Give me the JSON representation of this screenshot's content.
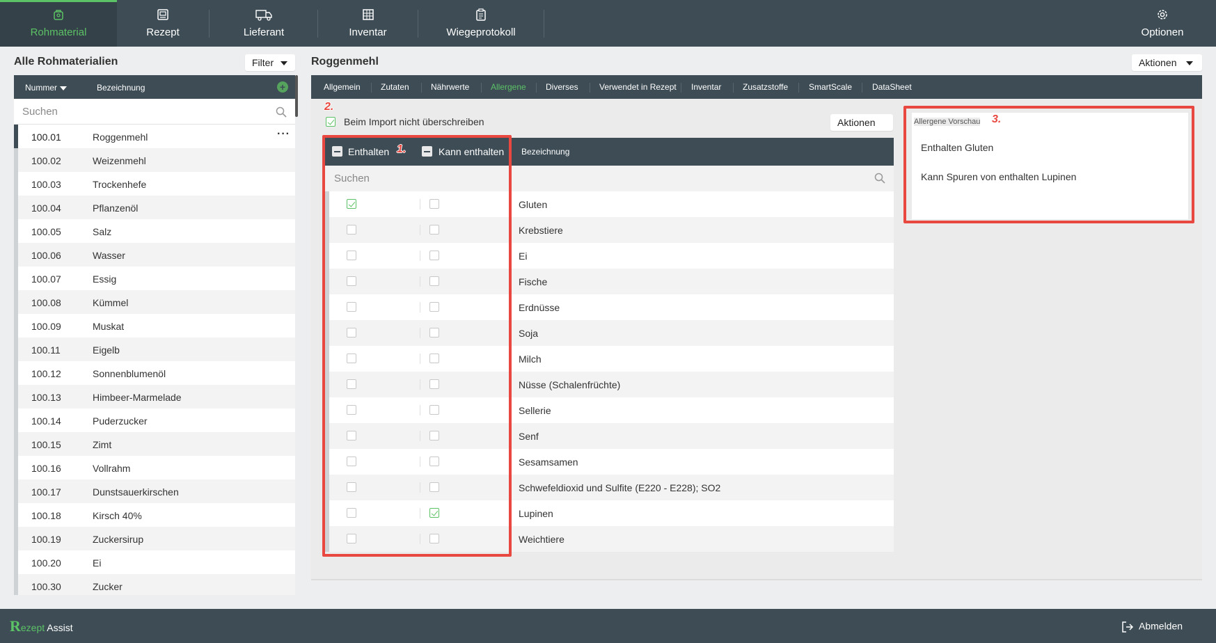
{
  "nav": {
    "items": [
      {
        "label": "Rohmaterial",
        "icon": "raw-material-icon",
        "active": true
      },
      {
        "label": "Rezept",
        "icon": "recipe-icon",
        "active": false
      },
      {
        "label": "Lieferant",
        "icon": "truck-icon",
        "active": false
      },
      {
        "label": "Inventar",
        "icon": "inventory-icon",
        "active": false
      },
      {
        "label": "Wiegeprotokoll",
        "icon": "clipboard-icon",
        "active": false
      }
    ],
    "options_label": "Optionen"
  },
  "left": {
    "title": "Alle Rohmaterialien",
    "filter_label": "Filter",
    "col_number": "Nummer",
    "col_name": "Bezeichnung",
    "search_placeholder": "Suchen",
    "rows": [
      {
        "num": "100.01",
        "name": "Roggenmehl"
      },
      {
        "num": "100.02",
        "name": "Weizenmehl"
      },
      {
        "num": "100.03",
        "name": "Trockenhefe"
      },
      {
        "num": "100.04",
        "name": "Pflanzenöl"
      },
      {
        "num": "100.05",
        "name": "Salz"
      },
      {
        "num": "100.06",
        "name": "Wasser"
      },
      {
        "num": "100.07",
        "name": "Essig"
      },
      {
        "num": "100.08",
        "name": "Kümmel"
      },
      {
        "num": "100.09",
        "name": "Muskat"
      },
      {
        "num": "100.11",
        "name": "Eigelb"
      },
      {
        "num": "100.12",
        "name": "Sonnenblumenöl"
      },
      {
        "num": "100.13",
        "name": "Himbeer-Marmelade"
      },
      {
        "num": "100.14",
        "name": "Puderzucker"
      },
      {
        "num": "100.15",
        "name": "Zimt"
      },
      {
        "num": "100.16",
        "name": "Vollrahm"
      },
      {
        "num": "100.17",
        "name": "Dunstsauerkirschen"
      },
      {
        "num": "100.18",
        "name": "Kirsch 40%"
      },
      {
        "num": "100.19",
        "name": "Zuckersirup"
      },
      {
        "num": "100.20",
        "name": "Ei"
      },
      {
        "num": "100.30",
        "name": "Zucker"
      }
    ]
  },
  "right": {
    "title": "Roggenmehl",
    "actions_label": "Aktionen",
    "tabs": [
      {
        "label": "Allgemein",
        "active": false
      },
      {
        "label": "Zutaten",
        "active": false
      },
      {
        "label": "Nährwerte",
        "active": false
      },
      {
        "label": "Allergene",
        "active": true
      },
      {
        "label": "Diverses",
        "active": false
      },
      {
        "label": "Verwendet in Rezept",
        "active": false
      },
      {
        "label": "Inventar",
        "active": false
      },
      {
        "label": "Zusatzstoffe",
        "active": false
      },
      {
        "label": "SmartScale",
        "active": false
      },
      {
        "label": "DataSheet",
        "active": false
      }
    ],
    "import_label": "Beim Import nicht überschreiben",
    "import_checked": true,
    "inner_actions_label": "Aktionen",
    "col_contains": "Enthalten",
    "col_may_contain": "Kann enthalten",
    "col_name": "Bezeichnung",
    "search_placeholder": "Suchen",
    "allergens": [
      {
        "name": "Gluten",
        "contains": true,
        "may": false
      },
      {
        "name": "Krebstiere",
        "contains": false,
        "may": false
      },
      {
        "name": "Ei",
        "contains": false,
        "may": false
      },
      {
        "name": "Fische",
        "contains": false,
        "may": false
      },
      {
        "name": "Erdnüsse",
        "contains": false,
        "may": false
      },
      {
        "name": "Soja",
        "contains": false,
        "may": false
      },
      {
        "name": "Milch",
        "contains": false,
        "may": false
      },
      {
        "name": "Nüsse (Schalenfrüchte)",
        "contains": false,
        "may": false
      },
      {
        "name": "Sellerie",
        "contains": false,
        "may": false
      },
      {
        "name": "Senf",
        "contains": false,
        "may": false
      },
      {
        "name": "Sesamsamen",
        "contains": false,
        "may": false
      },
      {
        "name": "Schwefeldioxid und Sulfite (E220 - E228); SO2",
        "contains": false,
        "may": false
      },
      {
        "name": "Lupinen",
        "contains": false,
        "may": true
      },
      {
        "name": "Weichtiere",
        "contains": false,
        "may": false
      }
    ],
    "preview_label": "Allergene Vorschau",
    "preview_lines": [
      "Enthalten Gluten",
      "Kann Spuren von enthalten Lupinen"
    ]
  },
  "annotations": [
    "1.",
    "2.",
    "3."
  ],
  "footer": {
    "logo_r": "R",
    "logo_ezept": "ezept",
    "logo_assist": "Assist",
    "logout_label": "Abmelden"
  },
  "colors": {
    "accent": "#5cc266",
    "header": "#3d4c55",
    "annotation": "#e8483f"
  }
}
